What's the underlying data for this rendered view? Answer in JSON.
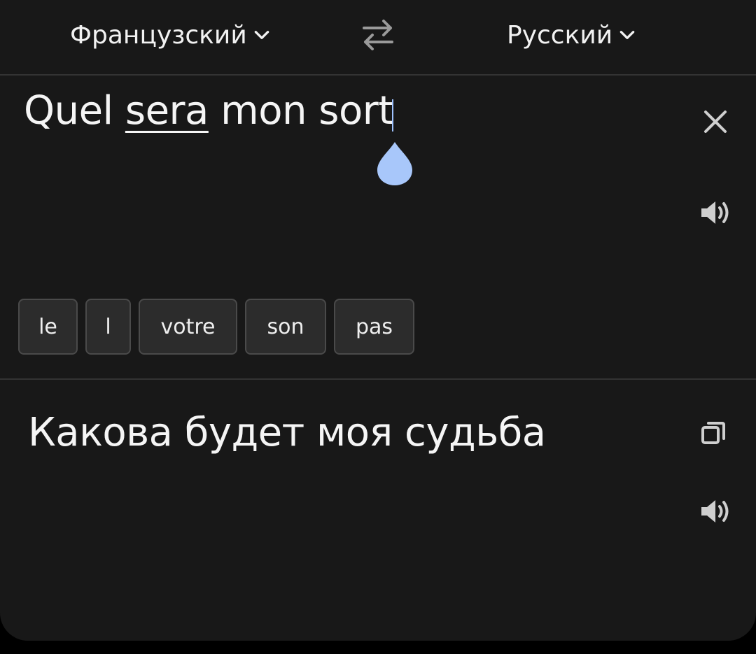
{
  "language_bar": {
    "source_language": "Французский",
    "target_language": "Русский"
  },
  "input": {
    "before_underline": "Quel ",
    "underlined_word": "sera",
    "after_underline": " mon sort"
  },
  "suggestions": [
    "le",
    "l",
    "votre",
    "son",
    "pas"
  ],
  "output": {
    "translation": "Какова будет моя судьба"
  },
  "icons": {
    "swap": "swap-languages-icon",
    "chevron": "chevron-down-icon",
    "clear": "close-icon",
    "speaker": "speaker-icon",
    "copy": "copy-icon",
    "handle": "text-selection-handle"
  },
  "colors": {
    "background": "#181818",
    "text": "#f5f5f5",
    "icon": "#cfcfcf",
    "handle": "#a8c7fa",
    "chip_bg": "#2c2c2c",
    "chip_border": "#4a4a4a"
  }
}
